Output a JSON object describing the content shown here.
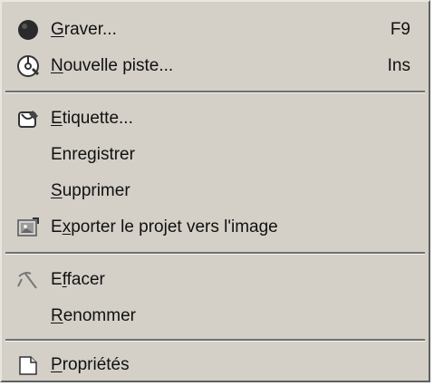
{
  "menu": {
    "items": [
      {
        "label": "Graver...",
        "mnemonic": "G",
        "shortcut": "F9",
        "icon": "burn-disc-icon"
      },
      {
        "label": "Nouvelle piste...",
        "mnemonic": "N",
        "shortcut": "Ins",
        "icon": "new-track-icon"
      },
      {
        "label": "Etiquette...",
        "mnemonic": "E",
        "shortcut": "",
        "icon": "label-icon"
      },
      {
        "label": "Enregistrer",
        "mnemonic": "g",
        "shortcut": "",
        "icon": ""
      },
      {
        "label": "Supprimer",
        "mnemonic": "S",
        "shortcut": "",
        "icon": ""
      },
      {
        "label": "Exporter le projet vers l'image",
        "mnemonic": "x",
        "shortcut": "",
        "icon": "export-image-icon"
      },
      {
        "label": "Effacer",
        "mnemonic": "f",
        "shortcut": "",
        "icon": "erase-icon"
      },
      {
        "label": "Renommer",
        "mnemonic": "R",
        "shortcut": "",
        "icon": ""
      },
      {
        "label": "Propriétés",
        "mnemonic": "P",
        "shortcut": "",
        "icon": "properties-icon"
      }
    ]
  },
  "colors": {
    "menu_background": "#d4d0c8",
    "text": "#111111",
    "separator_dark": "#6e6e6e",
    "separator_light": "#f4f4f4"
  }
}
